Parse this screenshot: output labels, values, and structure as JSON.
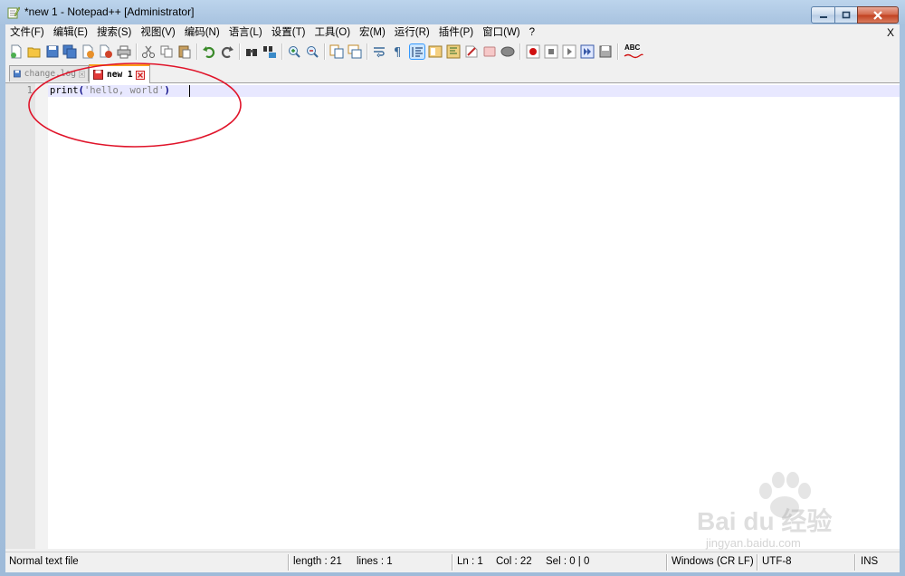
{
  "window": {
    "title": "*new 1 - Notepad++ [Administrator]"
  },
  "menubar": {
    "items": [
      "文件(F)",
      "编辑(E)",
      "搜索(S)",
      "视图(V)",
      "编码(N)",
      "语言(L)",
      "设置(T)",
      "工具(O)",
      "宏(M)",
      "运行(R)",
      "插件(P)",
      "窗口(W)",
      "?"
    ],
    "close_label": "X"
  },
  "toolbar": {
    "buttons": [
      "new-file-icon",
      "open-file-icon",
      "save-icon",
      "save-all-icon",
      "close-icon",
      "close-all-icon",
      "print-icon",
      "cut-icon",
      "copy-icon",
      "paste-icon",
      "undo-icon",
      "redo-icon",
      "find-icon",
      "replace-icon",
      "zoom-in-icon",
      "zoom-out-icon",
      "sync-v-icon",
      "sync-h-icon",
      "word-wrap-icon",
      "show-all-chars-icon",
      "indent-guide-icon",
      "doc-map-icon",
      "function-list-icon",
      "folder-workspace-icon",
      "monitoring-icon",
      "record-macro-icon",
      "stop-record-icon",
      "play-macro-icon",
      "run-macro-multi-icon",
      "save-macro-icon",
      "spell-check-icon"
    ],
    "spellcheck_label": "ABC"
  },
  "tabs": [
    {
      "label": "change.log",
      "active": false
    },
    {
      "label": "new 1",
      "active": true
    }
  ],
  "editor": {
    "lines": [
      {
        "number": "1",
        "code_fn": "print",
        "code_open": "(",
        "code_str": "'hello, world'",
        "code_close": ")"
      }
    ]
  },
  "statusbar": {
    "file_type": "Normal text file",
    "length": "length : 21",
    "lines": "lines : 1",
    "ln": "Ln : 1",
    "col": "Col : 22",
    "sel": "Sel : 0 | 0",
    "eol": "Windows (CR LF)",
    "encoding": "UTF-8",
    "mode": "INS"
  },
  "watermark": {
    "brand": "Bai du 经验",
    "url": "jingyan.baidu.com"
  },
  "colors": {
    "accent": "#fa9e1b",
    "annotation": "#e0142a",
    "current_line": "#e8e8ff"
  }
}
